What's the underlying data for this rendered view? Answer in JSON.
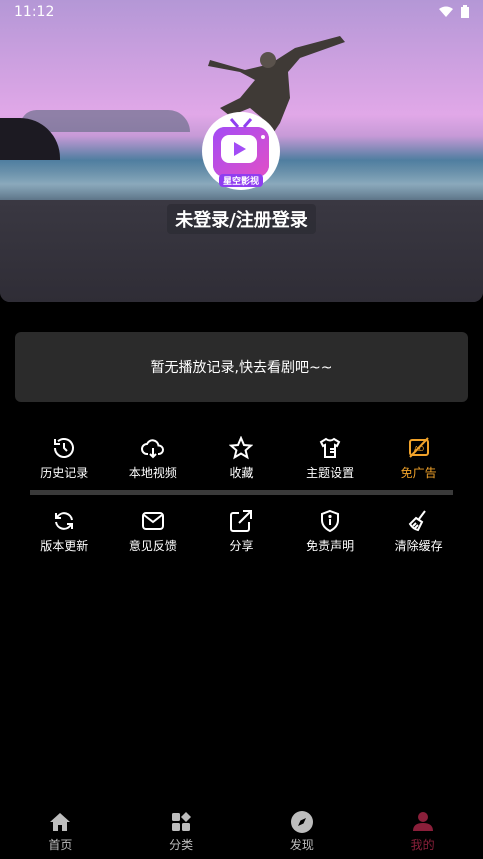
{
  "status": {
    "time": "11:12"
  },
  "profile": {
    "login_text": "未登录/注册登录",
    "logo_text": "星空影视"
  },
  "history": {
    "empty_text": "暂无播放记录,快去看剧吧~~"
  },
  "menu_row1": [
    {
      "label": "历史记录",
      "icon": "history-icon"
    },
    {
      "label": "本地视频",
      "icon": "cloud-download-icon"
    },
    {
      "label": "收藏",
      "icon": "star-icon"
    },
    {
      "label": "主题设置",
      "icon": "shirt-icon"
    },
    {
      "label": "免广告",
      "icon": "no-ad-icon"
    }
  ],
  "menu_row2": [
    {
      "label": "版本更新",
      "icon": "refresh-icon"
    },
    {
      "label": "意见反馈",
      "icon": "mail-icon"
    },
    {
      "label": "分享",
      "icon": "share-icon"
    },
    {
      "label": "免责声明",
      "icon": "shield-icon"
    },
    {
      "label": "清除缓存",
      "icon": "broom-icon"
    }
  ],
  "tabs": [
    {
      "label": "首页",
      "icon": "home-icon"
    },
    {
      "label": "分类",
      "icon": "category-icon"
    },
    {
      "label": "发现",
      "icon": "compass-icon"
    },
    {
      "label": "我的",
      "icon": "user-icon",
      "active": true
    }
  ],
  "colors": {
    "accent_orange": "#f0a22a",
    "active_tab": "#8a1f3a",
    "card_bg": "#2b2b2b"
  }
}
